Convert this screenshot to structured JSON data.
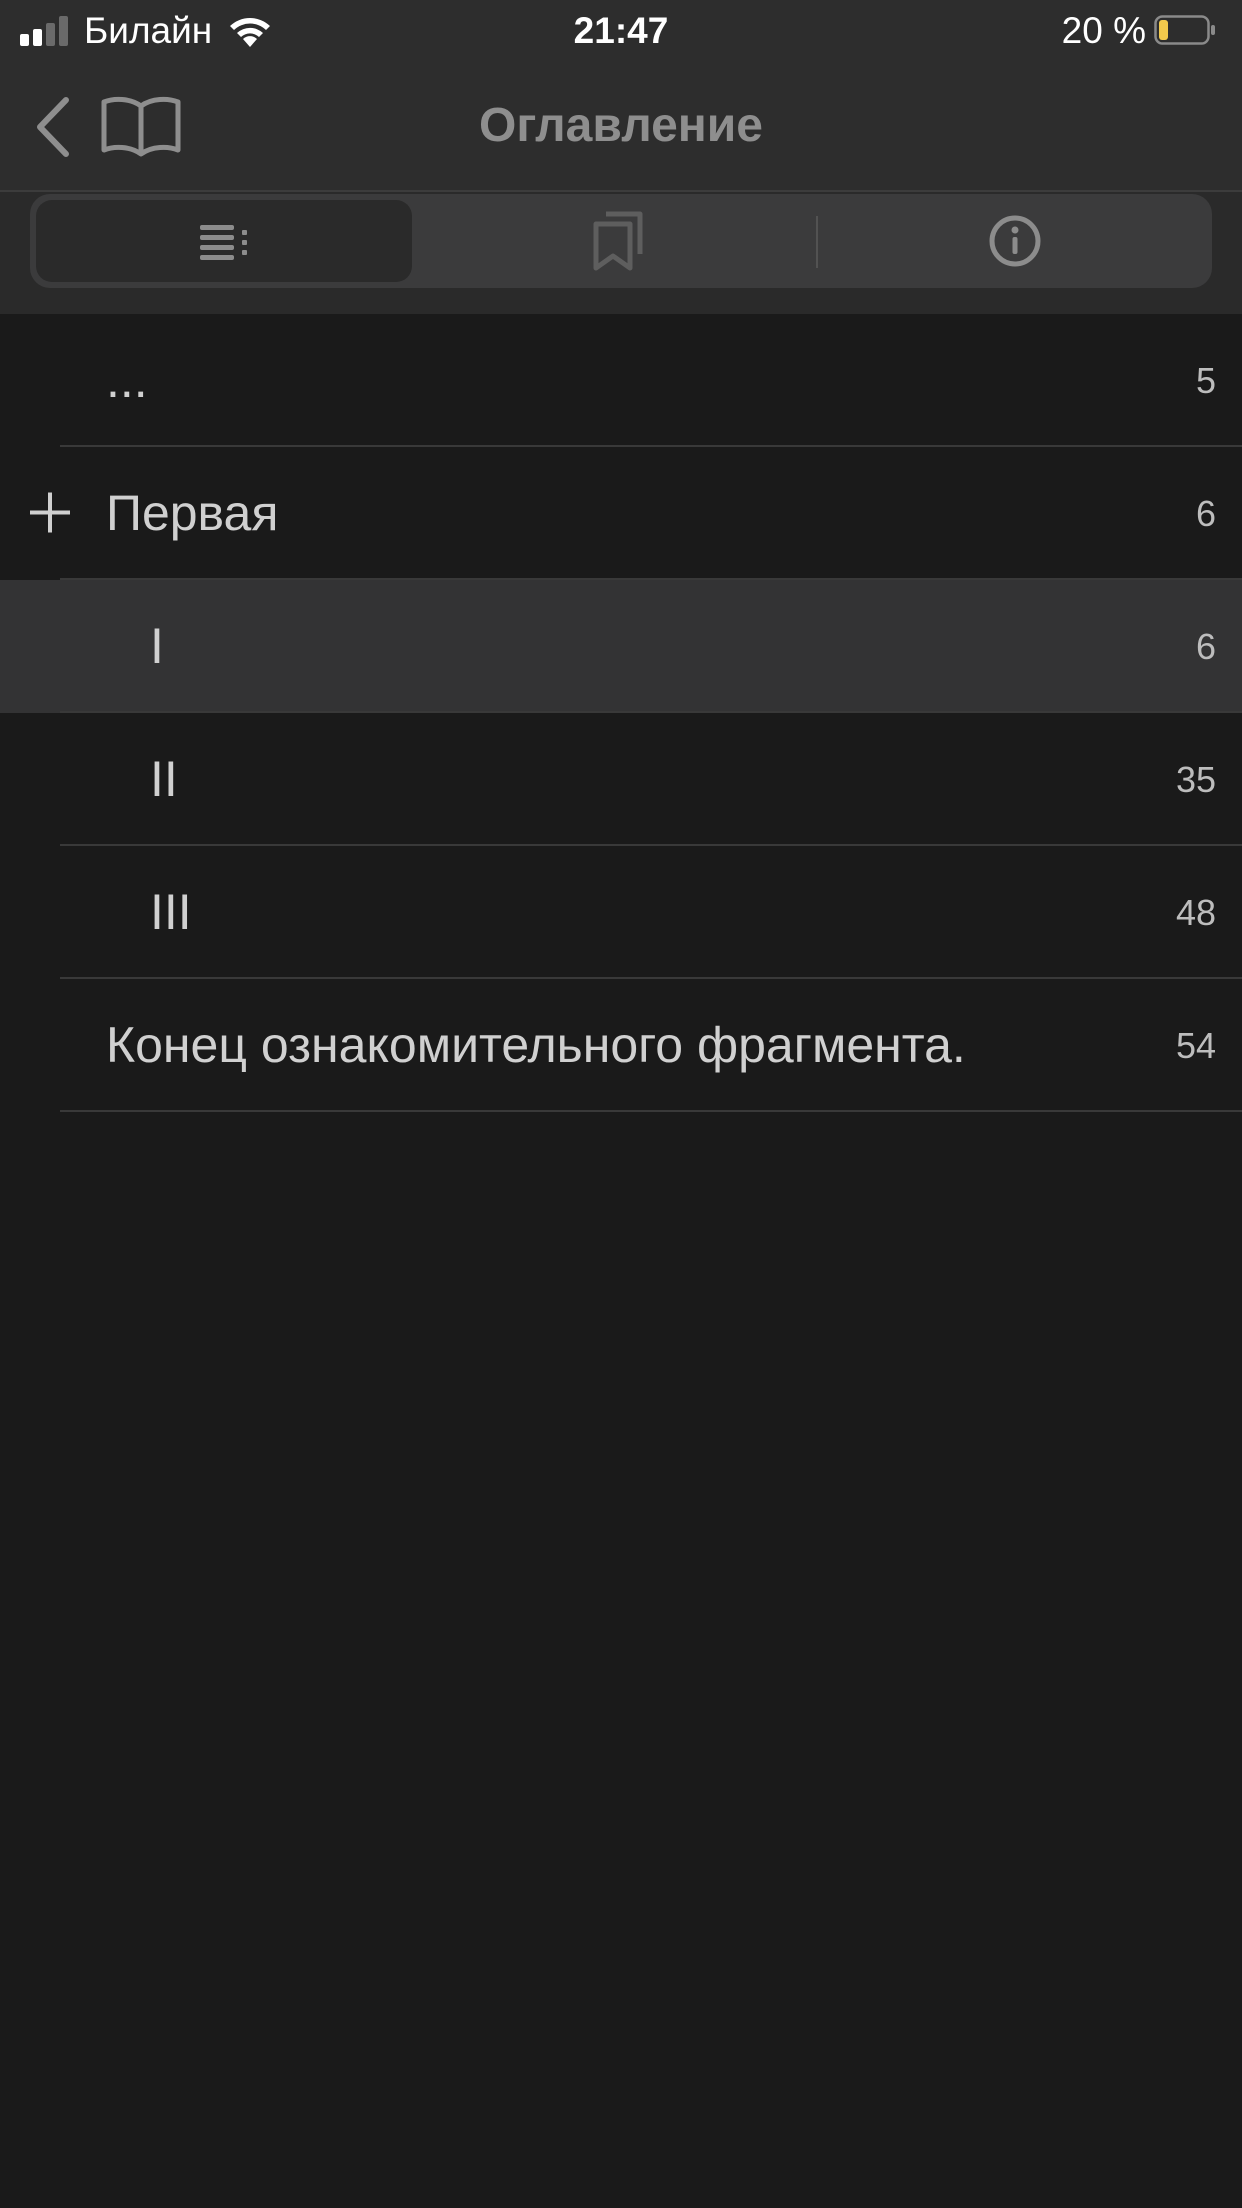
{
  "status_bar": {
    "carrier": "Билайн",
    "time": "21:47",
    "battery_percent": "20 %",
    "battery_level": 0.2,
    "battery_color": "#f2c94c",
    "signal_bars_active": 2,
    "signal_bars_total": 4
  },
  "nav": {
    "title": "Оглавление",
    "back_icon": "chevron-left-icon",
    "book_icon": "book-open-icon"
  },
  "segments": [
    {
      "icon": "list-icon",
      "selected": true
    },
    {
      "icon": "bookmarks-icon",
      "selected": false
    },
    {
      "icon": "info-icon",
      "selected": false
    }
  ],
  "toc": [
    {
      "label": "...",
      "page": "5",
      "level": 0,
      "expandable": false,
      "highlighted": false
    },
    {
      "label": "Первая",
      "page": "6",
      "level": 0,
      "expandable": true,
      "highlighted": false
    },
    {
      "label": "I",
      "page": "6",
      "level": 1,
      "expandable": false,
      "highlighted": true
    },
    {
      "label": "II",
      "page": "35",
      "level": 1,
      "expandable": false,
      "highlighted": false
    },
    {
      "label": "III",
      "page": "48",
      "level": 1,
      "expandable": false,
      "highlighted": false
    },
    {
      "label": "Конец ознакомительного фрагмента.",
      "page": "54",
      "level": 0,
      "expandable": false,
      "highlighted": false
    }
  ],
  "colors": {
    "background": "#1a1a1a",
    "bar": "#2d2d2d",
    "highlight": "#333334",
    "accent_battery": "#f2c94c"
  }
}
